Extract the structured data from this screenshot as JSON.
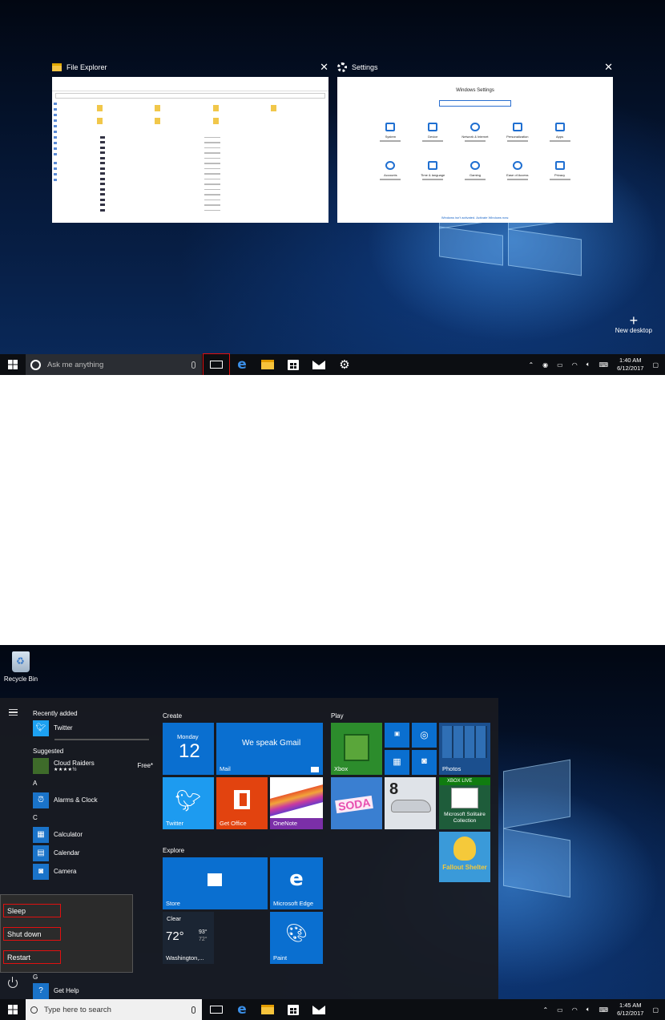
{
  "task_view": {
    "windows": [
      {
        "title": "File Explorer",
        "close_glyph": "✕"
      },
      {
        "title": "Settings",
        "close_glyph": "✕",
        "header": "Windows Settings",
        "items": [
          "System",
          "Device",
          "Network & Internet",
          "Personalization",
          "Apps",
          "Accounts",
          "Time & language",
          "Gaming",
          "Ease of Access",
          "Privacy"
        ],
        "activation_link": "Windows isn't activated. Activate Windows now."
      }
    ],
    "new_desktop_label": "New desktop",
    "new_desktop_glyph": "+"
  },
  "taskbar_top": {
    "search_placeholder": "Ask me anything",
    "time": "1:40 AM",
    "date": "6/12/2017"
  },
  "desktop": {
    "recycle_bin_label": "Recycle Bin"
  },
  "start_menu": {
    "recently_added_label": "Recently added",
    "recent_app": "Twitter",
    "suggested_label": "Suggested",
    "suggested_app": "Cloud Raiders",
    "suggested_rating": "★★★★½",
    "suggested_price": "Free*",
    "letter_a": "A",
    "alarms": "Alarms & Clock",
    "letter_c": "C",
    "calculator": "Calculator",
    "calendar": "Calendar",
    "camera": "Camera",
    "letter_g": "G",
    "get_help": "Get Help",
    "power_options": {
      "sleep": "Sleep",
      "shutdown": "Shut down",
      "restart": "Restart"
    },
    "groups": {
      "create": "Create",
      "play": "Play",
      "explore": "Explore"
    },
    "tiles": {
      "calendar_day": "Monday",
      "calendar_date": "12",
      "mail_text": "We speak Gmail",
      "mail_label": "Mail",
      "twitter": "Twitter",
      "office": "Get Office",
      "onenote": "OneNote",
      "xbox": "Xbox",
      "photos": "Photos",
      "solitaire_badge": "XBOX LIVE",
      "solitaire": "Microsoft Solitaire Collection",
      "store": "Store",
      "edge": "Microsoft Edge",
      "weather_cond": "Clear",
      "weather_temp": "72°",
      "weather_hi": "93°",
      "weather_lo": "72°",
      "weather_city": "Washington,...",
      "paint": "Paint",
      "candy": "SODA",
      "fallout": "Fallout Shelter"
    }
  },
  "taskbar_bottom": {
    "search_placeholder": "Type here to search",
    "time": "1:45 AM",
    "date": "6/12/2017"
  },
  "colors": {
    "accent": "#0a6fd0",
    "highlight": "#e01010",
    "taskbar": "#0c0e12"
  }
}
